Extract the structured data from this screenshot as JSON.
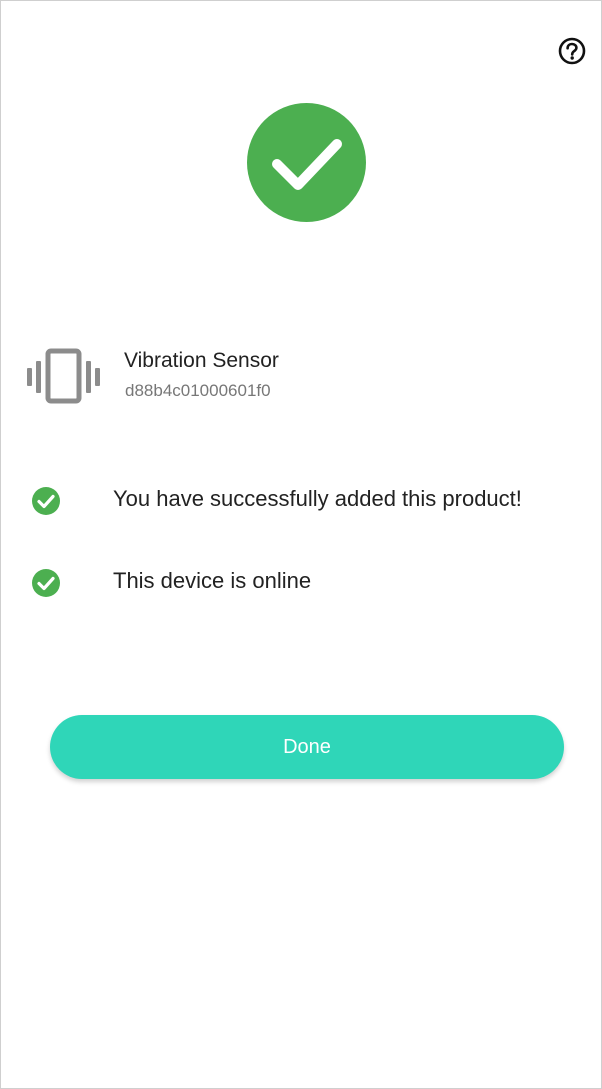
{
  "header": {
    "help_icon": "question-circle-icon"
  },
  "result": {
    "icon": "check-circle-icon",
    "color": "#4caf50"
  },
  "device": {
    "icon": "vibration-icon",
    "name": "Vibration Sensor",
    "id": "d88b4c01000601f0"
  },
  "status_items": [
    {
      "icon": "check-circle-icon",
      "text": "You have successfully added this product!"
    },
    {
      "icon": "check-circle-icon",
      "text": "This device is online"
    }
  ],
  "actions": {
    "done_label": "Done",
    "done_color": "#2fd6b8"
  }
}
